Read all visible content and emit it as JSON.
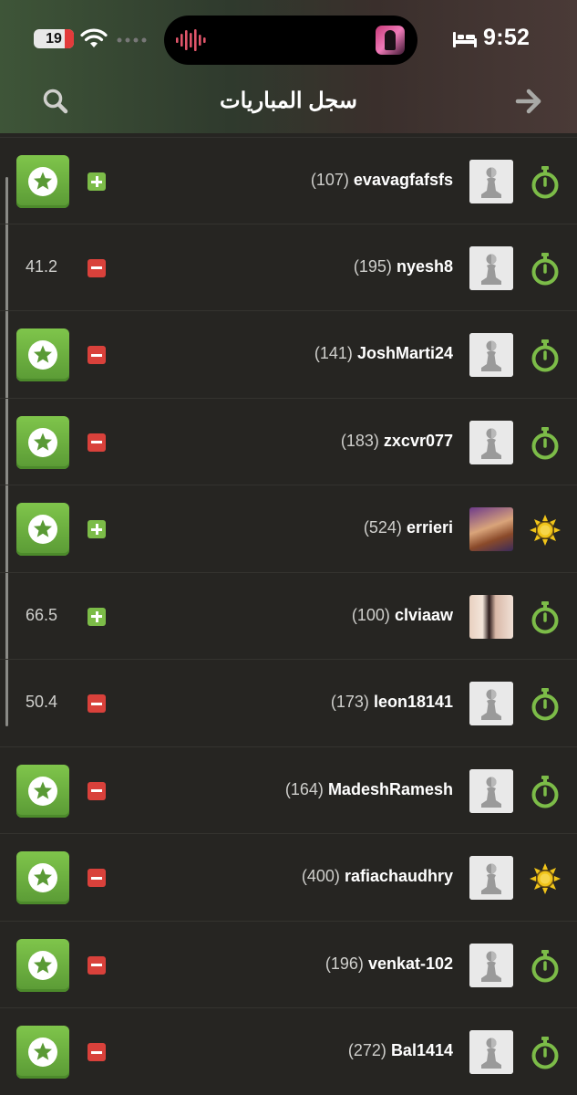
{
  "status_bar": {
    "battery_level": "19",
    "time": "9:52"
  },
  "header": {
    "title": "سجل المباريات"
  },
  "colors": {
    "background": "#262522",
    "win": "#7cbc48",
    "loss": "#d9413b",
    "daily_clock": "#7cbc48",
    "blitz_sun": "#f0c419"
  },
  "games": [
    {
      "review": "star",
      "accuracy": "",
      "result": "win",
      "rating": "(107)",
      "name": "evavagfafsfs",
      "avatar": "pawn",
      "mode": "clock-icon"
    },
    {
      "review": "",
      "accuracy": "41.2",
      "result": "loss",
      "rating": "(195)",
      "name": "nyesh8",
      "avatar": "pawn",
      "mode": "clock-icon"
    },
    {
      "review": "star",
      "accuracy": "",
      "result": "loss",
      "rating": "(141)",
      "name": "JoshMarti24",
      "avatar": "pawn",
      "mode": "clock-icon"
    },
    {
      "review": "star",
      "accuracy": "",
      "result": "loss",
      "rating": "(183)",
      "name": "zxcvr077",
      "avatar": "pawn",
      "mode": "clock-icon"
    },
    {
      "review": "star",
      "accuracy": "",
      "result": "win",
      "rating": "(524)",
      "name": "errieri",
      "avatar": "photo1",
      "mode": "sun-icon"
    },
    {
      "review": "",
      "accuracy": "66.5",
      "result": "win",
      "rating": "(100)",
      "name": "clviaaw",
      "avatar": "photo2",
      "mode": "clock-icon"
    },
    {
      "review": "",
      "accuracy": "50.4",
      "result": "loss",
      "rating": "(173)",
      "name": "leon18141",
      "avatar": "pawn",
      "mode": "clock-icon"
    },
    {
      "review": "star",
      "accuracy": "",
      "result": "loss",
      "rating": "(164)",
      "name": "MadeshRamesh",
      "avatar": "pawn",
      "mode": "clock-icon"
    },
    {
      "review": "star",
      "accuracy": "",
      "result": "loss",
      "rating": "(400)",
      "name": "rafiachaudhry",
      "avatar": "pawn",
      "mode": "sun-icon"
    },
    {
      "review": "star",
      "accuracy": "",
      "result": "loss",
      "rating": "(196)",
      "name": "venkat-102",
      "avatar": "pawn",
      "mode": "clock-icon"
    },
    {
      "review": "star",
      "accuracy": "",
      "result": "loss",
      "rating": "(272)",
      "name": "Bal1414",
      "avatar": "pawn",
      "mode": "clock-icon"
    }
  ]
}
